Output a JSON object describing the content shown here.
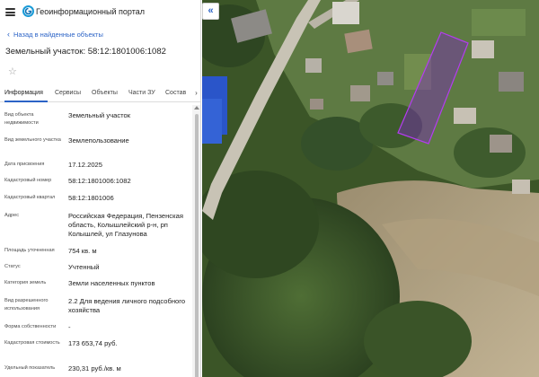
{
  "app": {
    "title": "Геоинформационный портал"
  },
  "nav": {
    "back_label": "Назад в найденные объекты"
  },
  "parcel": {
    "title": "Земельный участок: 58:12:1801006:1082"
  },
  "tabs": [
    {
      "label": "Информация",
      "active": true
    },
    {
      "label": "Сервисы",
      "active": false
    },
    {
      "label": "Объекты",
      "active": false
    },
    {
      "label": "Части ЗУ",
      "active": false
    },
    {
      "label": "Состав",
      "active": false
    }
  ],
  "info": [
    {
      "label": "Вид объекта недвижимости",
      "value": "Земельный участок"
    },
    {
      "label": "Вид земельного участка",
      "value": "Землепользование"
    },
    {
      "label": "Дата присвоения",
      "value": "17.12.2025"
    },
    {
      "label": "Кадастровый номер",
      "value": "58:12:1801006:1082"
    },
    {
      "label": "Кадастровый квартал",
      "value": "58:12:1801006"
    },
    {
      "label": "Адрес",
      "value": "Российская Федерация, Пензенская область, Колышлейский р-н, рп Колышлей, ул Глазунова"
    },
    {
      "label": "Площадь уточненная",
      "value": "754 кв. м"
    },
    {
      "label": "Статус",
      "value": "Учтенный"
    },
    {
      "label": "Категория земель",
      "value": "Земли населенных пунктов"
    },
    {
      "label": "Вид разрешенного использования",
      "value": "2.2 Для ведения личного подсобного хозяйства"
    },
    {
      "label": "Форма собственности",
      "value": "-"
    },
    {
      "label": "Кадастровая стоимость",
      "value": "173 653,74 руб."
    },
    {
      "label": "Удельный показатель",
      "value": "230,31 руб./кв. м"
    }
  ],
  "colors": {
    "accent": "#2b63c6",
    "parcel_outline": "#9b2bd6",
    "parcel_fill": "#7a2bb8"
  },
  "icons": {
    "menu": "hamburger-icon",
    "logo": "portal-logo-icon",
    "back": "chevron-left-icon",
    "favorite": "star-icon",
    "tabs_next": "chevron-right-icon",
    "collapse": "double-chevron-left-icon"
  }
}
